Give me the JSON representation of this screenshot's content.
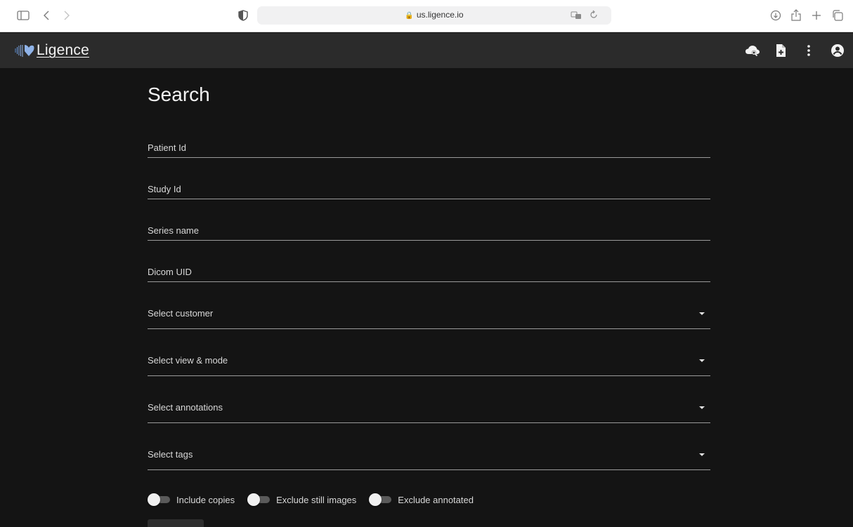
{
  "browser": {
    "url": "us.ligence.io",
    "icons": [
      "sidebar-icon",
      "back-icon",
      "forward-icon",
      "privacy-shield-icon",
      "lock-icon",
      "translate-icon",
      "reload-icon",
      "download-icon",
      "share-icon",
      "new-tab-icon",
      "tabs-overview-icon"
    ]
  },
  "app": {
    "logo_text": "Ligence",
    "icons": [
      "cloud-search-icon",
      "file-add-icon",
      "more-vert-icon",
      "account-icon"
    ]
  },
  "page": {
    "title": "Search"
  },
  "fields": {
    "patient_id": "Patient Id",
    "study_id": "Study Id",
    "series_name": "Series name",
    "dicom_uid": "Dicom UID"
  },
  "selects": {
    "customer": "Select customer",
    "view_mode": "Select view & mode",
    "annotations": "Select annotations",
    "tags": "Select tags"
  },
  "toggles": {
    "include_copies": "Include copies",
    "exclude_still_images": "Exclude still images",
    "exclude_annotated": "Exclude annotated"
  },
  "colors": {
    "background": "#141414",
    "app_bar": "#2b2b2b",
    "text": "#f2f2f2",
    "underline": "#9a9a9a"
  }
}
